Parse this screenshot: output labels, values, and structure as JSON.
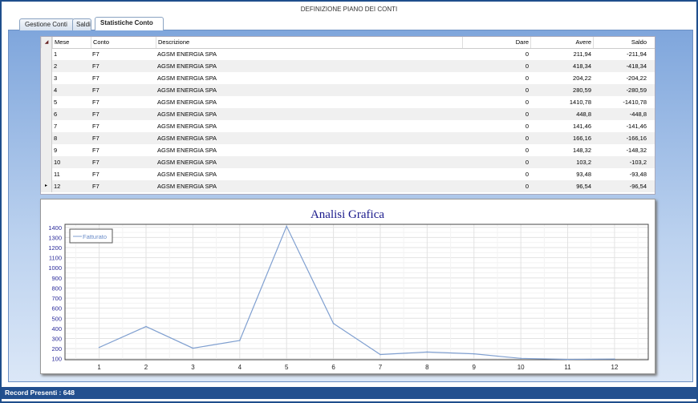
{
  "window": {
    "title": "DEFINIZIONE PIANO DEI CONTI"
  },
  "tabs": [
    {
      "label": "Gestione Conti"
    },
    {
      "label": "Saldi"
    },
    {
      "label": "Statistiche Conto"
    }
  ],
  "grid": {
    "columns": [
      "Mese",
      "Conto",
      "Descrizione",
      "Dare",
      "Avere",
      "Saldo"
    ],
    "rows": [
      [
        "1",
        "F7",
        "AGSM ENERGIA SPA",
        "0",
        "211,94",
        "-211,94"
      ],
      [
        "2",
        "F7",
        "AGSM ENERGIA SPA",
        "0",
        "418,34",
        "-418,34"
      ],
      [
        "3",
        "F7",
        "AGSM ENERGIA SPA",
        "0",
        "204,22",
        "-204,22"
      ],
      [
        "4",
        "F7",
        "AGSM ENERGIA SPA",
        "0",
        "280,59",
        "-280,59"
      ],
      [
        "5",
        "F7",
        "AGSM ENERGIA SPA",
        "0",
        "1410,78",
        "-1410,78"
      ],
      [
        "6",
        "F7",
        "AGSM ENERGIA SPA",
        "0",
        "448,8",
        "-448,8"
      ],
      [
        "7",
        "F7",
        "AGSM ENERGIA SPA",
        "0",
        "141,46",
        "-141,46"
      ],
      [
        "8",
        "F7",
        "AGSM ENERGIA SPA",
        "0",
        "166,16",
        "-166,16"
      ],
      [
        "9",
        "F7",
        "AGSM ENERGIA SPA",
        "0",
        "148,32",
        "-148,32"
      ],
      [
        "10",
        "F7",
        "AGSM ENERGIA SPA",
        "0",
        "103,2",
        "-103,2"
      ],
      [
        "11",
        "F7",
        "AGSM ENERGIA SPA",
        "0",
        "93,48",
        "-93,48"
      ],
      [
        "12",
        "F7",
        "AGSM ENERGIA SPA",
        "0",
        "96,54",
        "-96,54"
      ]
    ]
  },
  "chart_data": {
    "type": "line",
    "title": "Analisi Grafica",
    "categories": [
      "1",
      "2",
      "3",
      "4",
      "5",
      "6",
      "7",
      "8",
      "9",
      "10",
      "11",
      "12"
    ],
    "series": [
      {
        "name": "Fatturato",
        "values": [
          211.94,
          418.34,
          204.22,
          280.59,
          1410.78,
          448.8,
          141.46,
          166.16,
          148.32,
          103.2,
          93.48,
          96.54
        ],
        "color": "#7f9fd0"
      }
    ],
    "yticks": [
      100,
      200,
      300,
      400,
      500,
      600,
      700,
      800,
      900,
      1000,
      1100,
      1200,
      1300,
      1400
    ],
    "ylim": [
      90,
      1430
    ],
    "legend": "top-left",
    "grid": true
  },
  "status": {
    "text": "Record Presenti : 648"
  }
}
